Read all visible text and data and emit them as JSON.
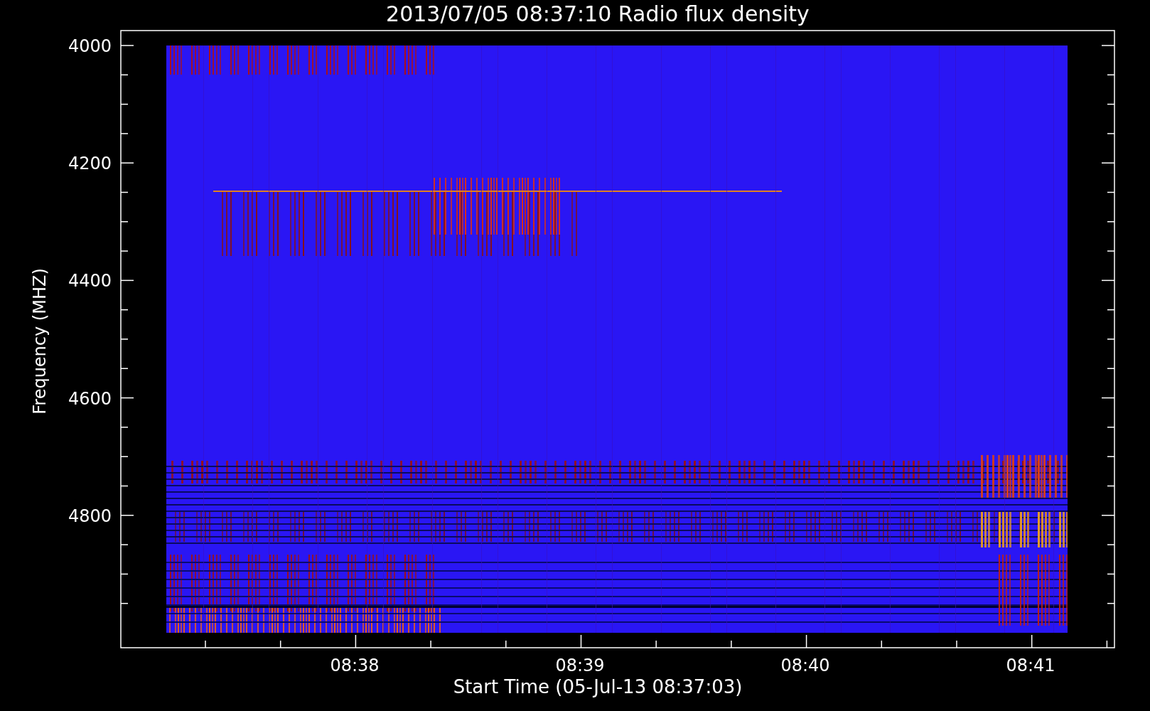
{
  "title": "2013/07/05 08:37:10 Radio flux density",
  "y_axis": {
    "title": "Frequency (MHZ)",
    "tick_labels": [
      "4000",
      "4200",
      "4400",
      "4600",
      "4800"
    ]
  },
  "x_axis": {
    "title": "Start Time (05-Jul-13 08:37:03)",
    "tick_labels": [
      "08:38",
      "08:39",
      "08:40",
      "08:41"
    ]
  }
}
